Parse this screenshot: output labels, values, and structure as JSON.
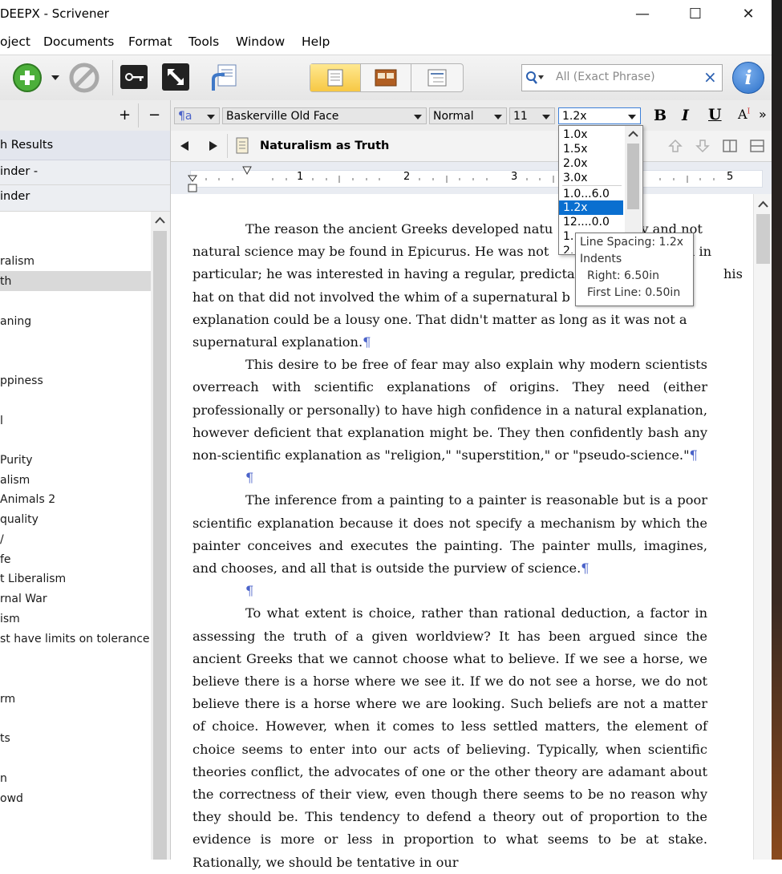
{
  "window": {
    "title": "DEEPX - Scrivener",
    "minimize": "—",
    "maximize": "☐",
    "close": "✕"
  },
  "menu": [
    "oject",
    "Documents",
    "Format",
    "Tools",
    "Window",
    "Help"
  ],
  "toolbar": {
    "search_placeholder": "All (Exact Phrase)",
    "search_clear": "×",
    "info": "i"
  },
  "formatbar": {
    "plus": "+",
    "minus": "−",
    "style_icon": "¶a",
    "font": "Baskerville Old Face",
    "weight": "Normal",
    "size": "11",
    "spacing": "1.2x",
    "bold": "B",
    "italic": "I",
    "underline": "U",
    "more": "»"
  },
  "binder": {
    "header1": "h Results",
    "header2": "inder -",
    "header3": "inder",
    "items": [
      "ralism",
      "th",
      "aning",
      "ppiness",
      "l",
      "Purity",
      "alism",
      "Animals 2",
      "quality",
      "/",
      "fe",
      "t Liberalism",
      "rnal War",
      "ism",
      "st have limits on tolerance",
      "rm",
      "ts",
      "n",
      "owd"
    ]
  },
  "editor": {
    "doc_title": "Naturalism as Truth",
    "ruler_numbers": [
      "1",
      "2",
      "3",
      "5"
    ]
  },
  "dropdown": {
    "options": [
      "1.0x",
      "1.5x",
      "2.0x",
      "3.0x",
      "1.0...6.0",
      "1.2x",
      "12....0.0",
      "1.",
      "2."
    ],
    "selected": "1.2x"
  },
  "tooltip": {
    "line1": "Line Spacing: 1.2x",
    "line2": "Indents",
    "line3": "Right: 6.50in",
    "line4": "First Line: 0.50in"
  },
  "document": {
    "p1_l1": "The reason the ancient Greeks developed natu",
    "p1_l1b": "y and not",
    "p1_l2": "natural science may be found in Epicurus.  He was not",
    "p1_l2b": "th in",
    "p1_l3": "particular; he was interested in having a regular, predictab",
    "p1_l3b": "his",
    "p1_l4": "hat on that did not involved the whim of a supernatural b",
    "p1_l5": "explanation could be a lousy one.  That didn't matter as long as it was not a",
    "p1_l6": "supernatural explanation.",
    "p2": "This desire to be free of fear may also explain why modern scientists overreach with scientific explanations of origins.  They need (either professionally or personally) to have high confidence in a natural explanation, however deficient that explanation might be.  They then confidently bash any non-scientific explanation as \"religion,\" \"superstition,\" or \"pseudo-science.\"",
    "p3": "The inference from a painting to a painter is reasonable but is a poor scientific explanation because it does not specify a mechanism by which the painter conceives and executes the painting.  The painter mulls, imagines, and chooses, and all that is outside the purview of science.",
    "p4": "To what extent is choice, rather than rational deduction, a factor in assessing the truth of a given worldview? It has been argued since the ancient Greeks that we cannot choose what to believe. If we see a horse, we believe there is a horse where we see it. If we do not see a horse, we do not believe there is a horse where we are looking. Such beliefs are not a matter of choice. However, when it comes to less settled matters, the element of choice seems to enter into our acts of believing. Typically, when scientific theories conflict, the advocates of one or the other theory are adamant about the correctness of their view, even though there seems to be no reason why they should be. This tendency to defend a theory out of proportion to the evidence is more or less in proportion to what seems to be at stake. Rationally, we should be tentative in our",
    "pilcrow": "¶"
  }
}
